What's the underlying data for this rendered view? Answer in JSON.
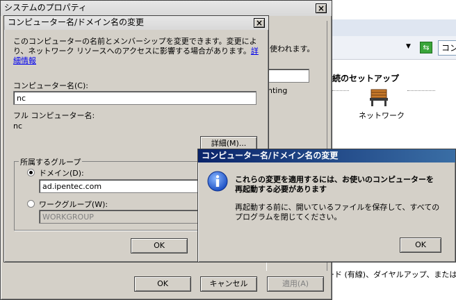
{
  "sys_props": {
    "title": "システムのプロパティ",
    "close": "×",
    "partial_text_1": "使われます。",
    "partial_text_2": "nting",
    "ok": "OK",
    "cancel": "キャンセル",
    "apply": "適用(A)"
  },
  "background_window": {
    "partial_text_top": "コン",
    "heading": "続のセットアップ",
    "network_label": "ネットワーク",
    "bottom_text": "ード (有線)、ダイヤルアップ、または V",
    "right_edge_char": "A"
  },
  "rename_dialog": {
    "title": "コンピューター名/ドメイン名の変更",
    "close": "×",
    "description": "このコンピューターの名前とメンバーシップを変更できます。変更により、ネットワーク リソースへのアクセスに影響する場合があります。",
    "more_info_link": "詳細情報",
    "computer_name_label": "コンピューター名(C):",
    "computer_name_value": "nc",
    "full_name_label": "フル コンピューター名:",
    "full_name_value": "nc",
    "details_button": "詳細(M)...",
    "member_of_group": "所属するグループ",
    "domain_radio": "ドメイン(D):",
    "domain_value": "ad.ipentec.com",
    "workgroup_radio": "ワークグループ(W):",
    "workgroup_value": "WORKGROUP",
    "ok": "OK"
  },
  "message_box": {
    "title": "コンピューター名/ドメイン名の変更",
    "icon": "info-icon",
    "main_text": "これらの変更を適用するには、お使いのコンピューターを再起動する必要があります",
    "sub_text": "再起動する前に、開いているファイルを保存して、すべてのプログラムを閉じてください。",
    "ok": "OK"
  }
}
